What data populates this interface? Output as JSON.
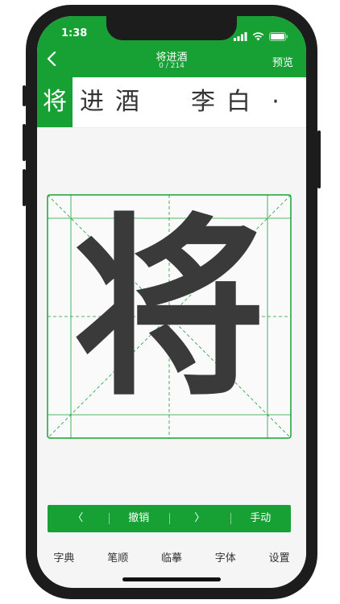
{
  "status": {
    "time": "1:38"
  },
  "nav": {
    "title": "将进酒",
    "subtitle": "0 / 214",
    "preview_label": "预览"
  },
  "char_bar": {
    "items": [
      {
        "char": "将",
        "active": true
      },
      {
        "char": "进",
        "active": false
      },
      {
        "char": "酒",
        "active": false
      },
      {
        "char": "李",
        "active": false
      },
      {
        "char": "白",
        "active": false
      },
      {
        "char": "·",
        "active": false
      }
    ]
  },
  "canvas": {
    "character": "将",
    "grid_color": "#17a134"
  },
  "controls": {
    "prev": "〈",
    "undo": "撤销",
    "next": "〉",
    "mode": "手动"
  },
  "tabs": [
    "字典",
    "笔顺",
    "临摹",
    "字体",
    "设置"
  ],
  "colors": {
    "accent": "#17a134",
    "background": "#f5f5f5"
  }
}
